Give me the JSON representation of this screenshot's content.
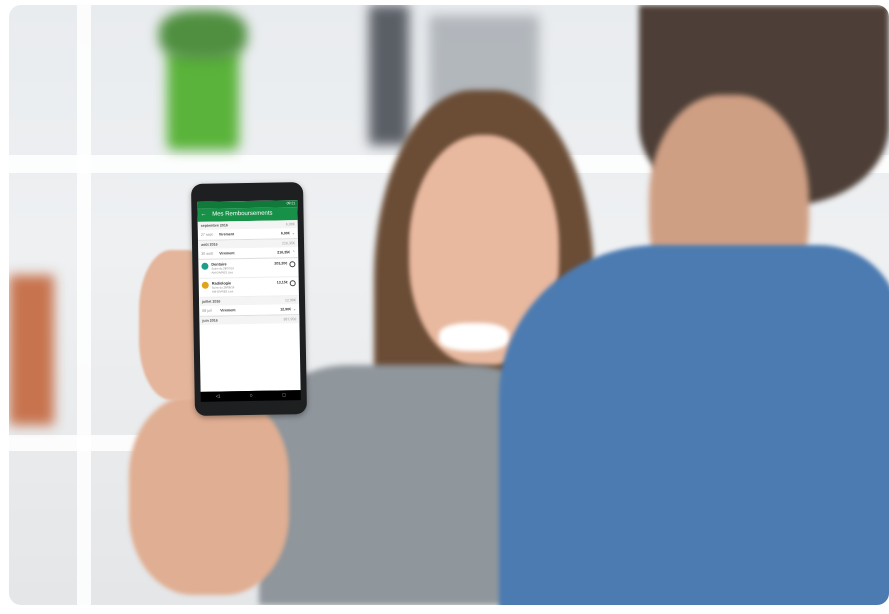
{
  "status_bar": {
    "time": "09:21"
  },
  "app_bar": {
    "title": "Mes Remboursements"
  },
  "months": [
    {
      "label": "septembre 2016",
      "total": "6,90€",
      "rows": [
        {
          "date": "27 sept",
          "status": "Virement",
          "amount": "6,90€",
          "chevron": "chevron-down"
        }
      ]
    },
    {
      "label": "août 2016",
      "total": "216,35€",
      "rows": [
        {
          "date": "30 août",
          "status": "Virement",
          "amount": "216,35€",
          "chevron": "chevron-up"
        }
      ],
      "cares": [
        {
          "icon": "tooth-icon",
          "color": "#1d9e8a",
          "title": "Dentaire",
          "sub1": "Soins du 28/07/16",
          "sub2": "AM-DIVRES Lisa",
          "amount": "203,20€"
        },
        {
          "icon": "radiology-icon",
          "color": "#e0a31c",
          "title": "Radiologie",
          "sub1": "Soins du 28/08/16",
          "sub2": "AM-DIVRES Lisa",
          "amount": "13,15€"
        }
      ]
    },
    {
      "label": "juillet 2016",
      "total": "12,90€",
      "rows": [
        {
          "date": "08 juil",
          "status": "Virement",
          "amount": "12,90€",
          "chevron": "chevron-down"
        }
      ]
    },
    {
      "label": "juin 2016",
      "total": "387,95€",
      "rows": []
    }
  ]
}
